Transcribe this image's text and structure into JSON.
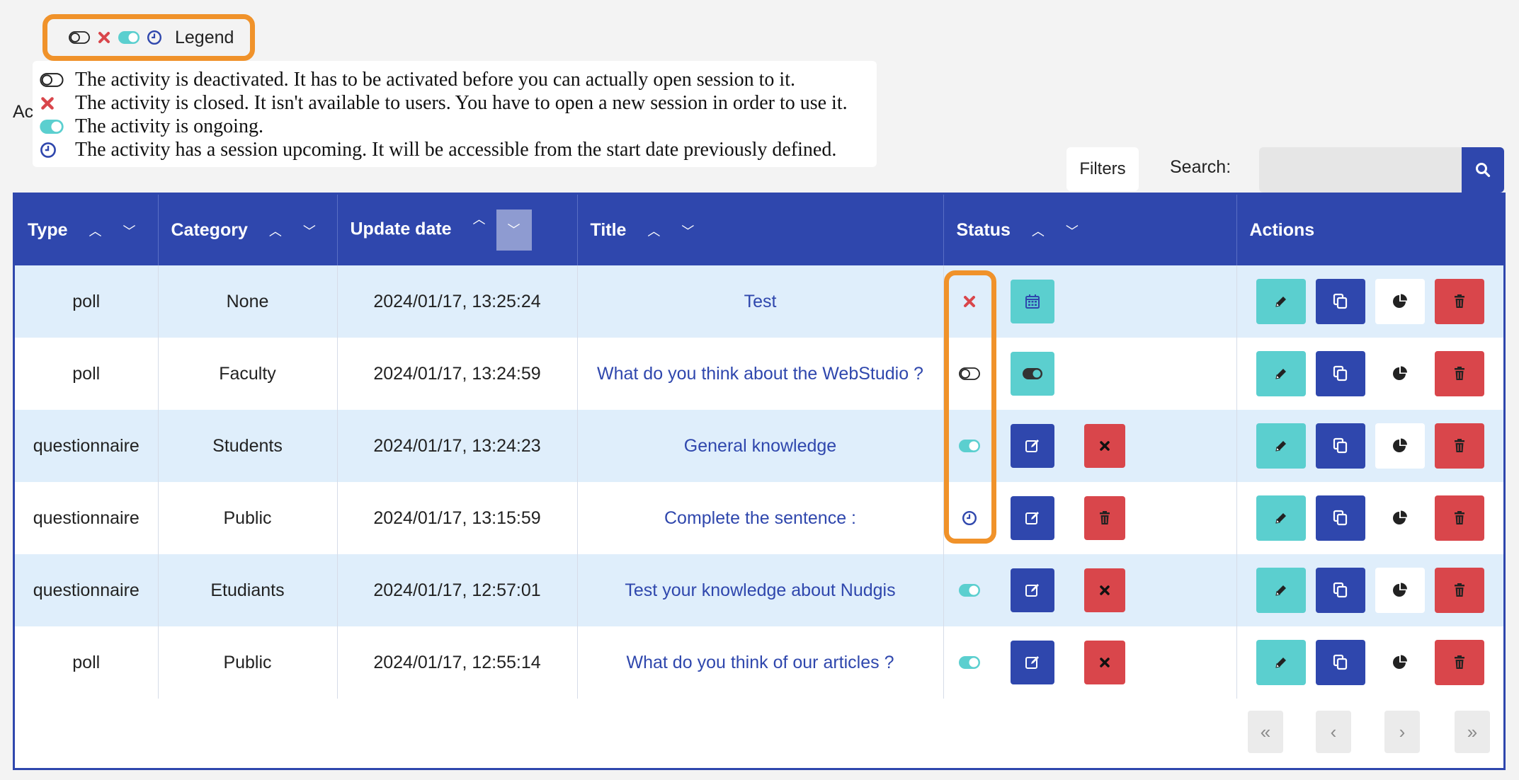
{
  "legend": {
    "toggle_label": "Legend",
    "items": [
      {
        "icon": "toggle-off-icon",
        "text": "The activity is deactivated. It has to be activated before you can actually open session to it."
      },
      {
        "icon": "closed-x-icon",
        "text": "The activity is closed. It isn't available to users. You have to open a new session in order to use it."
      },
      {
        "icon": "toggle-on-icon",
        "text": "The activity is ongoing."
      },
      {
        "icon": "clock-icon",
        "text": "The activity has a session upcoming. It will be accessible from the start date previously defined."
      }
    ]
  },
  "truncated_label": "Ac",
  "toolbar": {
    "filters_label": "Filters",
    "search_label": "Search:",
    "search_value": ""
  },
  "table": {
    "columns": [
      "Type",
      "Category",
      "Update date",
      "Title",
      "Status",
      "Actions"
    ],
    "rows": [
      {
        "type": "poll",
        "category": "None",
        "date": "2024/01/17, 13:25:24",
        "title": "Test",
        "status": "closed"
      },
      {
        "type": "poll",
        "category": "Faculty",
        "date": "2024/01/17, 13:24:59",
        "title": "What do you think about the WebStudio ?",
        "status": "deactivated"
      },
      {
        "type": "questionnaire",
        "category": "Students",
        "date": "2024/01/17, 13:24:23",
        "title": "General knowledge",
        "status": "ongoing"
      },
      {
        "type": "questionnaire",
        "category": "Public",
        "date": "2024/01/17, 13:15:59",
        "title": "Complete the sentence :",
        "status": "upcoming"
      },
      {
        "type": "questionnaire",
        "category": "Etudiants",
        "date": "2024/01/17, 12:57:01",
        "title": "Test your knowledge about Nudgis",
        "status": "ongoing"
      },
      {
        "type": "poll",
        "category": "Public",
        "date": "2024/01/17, 12:55:14",
        "title": "What do you think of our articles ?",
        "status": "ongoing"
      }
    ]
  },
  "colors": {
    "primary": "#2f47ad",
    "teal": "#5bcfcf",
    "red": "#d9464b",
    "highlight": "#f0922a"
  }
}
